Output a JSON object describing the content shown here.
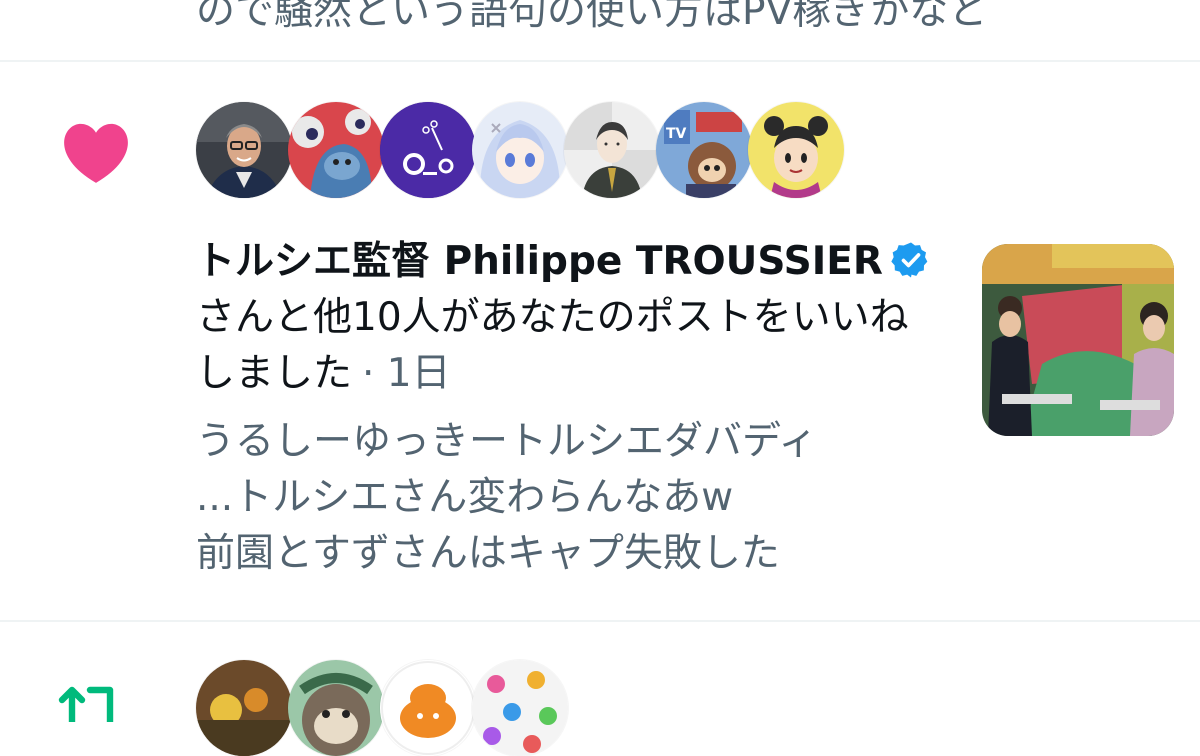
{
  "previous_notification": {
    "text": "ので騒然という語句の使い方はPV稼ぎかなと"
  },
  "like_notification": {
    "icon": "heart-icon",
    "icon_color": "#f91880",
    "actor_name": "トルシエ監督 Philippe TROUSSIER",
    "action_text": "さんと他10人があなたのポストをいいねしました",
    "time": "· 1日",
    "quoted_lines": [
      "うるしーゆっきートルシエダバディ",
      "...トルシエさん変わらんなあw",
      "前園とすずさんはキャプ失敗した"
    ],
    "verified_color": "#1d9bf0"
  },
  "retweet_notification": {
    "icon": "retweet-icon",
    "icon_color": "#00ba7c"
  },
  "colors": {
    "text_primary": "#0f1419",
    "text_secondary": "#536471",
    "divider": "#eff3f4"
  }
}
